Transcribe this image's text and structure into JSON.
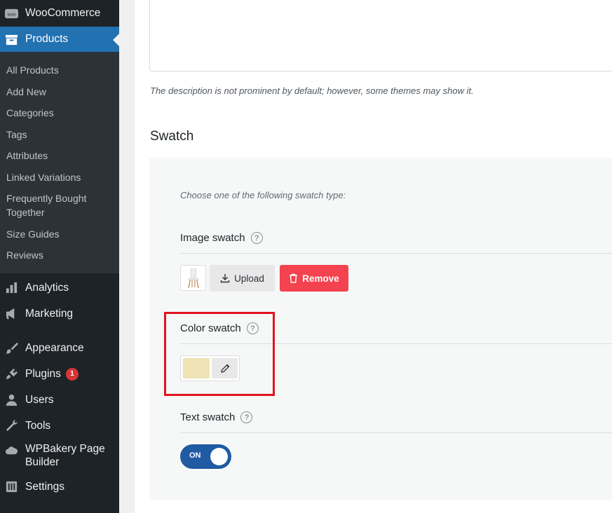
{
  "sidebar": {
    "woocommerce": "WooCommerce",
    "products": "Products",
    "products_sub": [
      "All Products",
      "Add New",
      "Categories",
      "Tags",
      "Attributes",
      "Linked Variations",
      "Frequently Bought Together",
      "Size Guides",
      "Reviews"
    ],
    "analytics": "Analytics",
    "marketing": "Marketing",
    "appearance": "Appearance",
    "plugins": "Plugins",
    "plugins_badge": "1",
    "users": "Users",
    "tools": "Tools",
    "wpbakery": "WPBakery Page Builder",
    "settings": "Settings",
    "woo_logo_text": "woo"
  },
  "main": {
    "description_note": "The description is not prominent by default; however, some themes may show it.",
    "section_title": "Swatch",
    "swatch": {
      "choose_note": "Choose one of the following swatch type:",
      "image_swatch_label": "Image swatch",
      "upload_label": "Upload",
      "remove_label": "Remove",
      "color_swatch_label": "Color swatch",
      "color_value": "#ede3b5",
      "text_swatch_label": "Text swatch",
      "toggle_label": "ON",
      "help_glyph": "?"
    }
  },
  "colors": {
    "sidebar_bg": "#1d2327",
    "accent": "#2271b1",
    "remove_button": "#f5424f",
    "toggle_on": "#1f5aa3",
    "highlight": "#e0141e"
  }
}
